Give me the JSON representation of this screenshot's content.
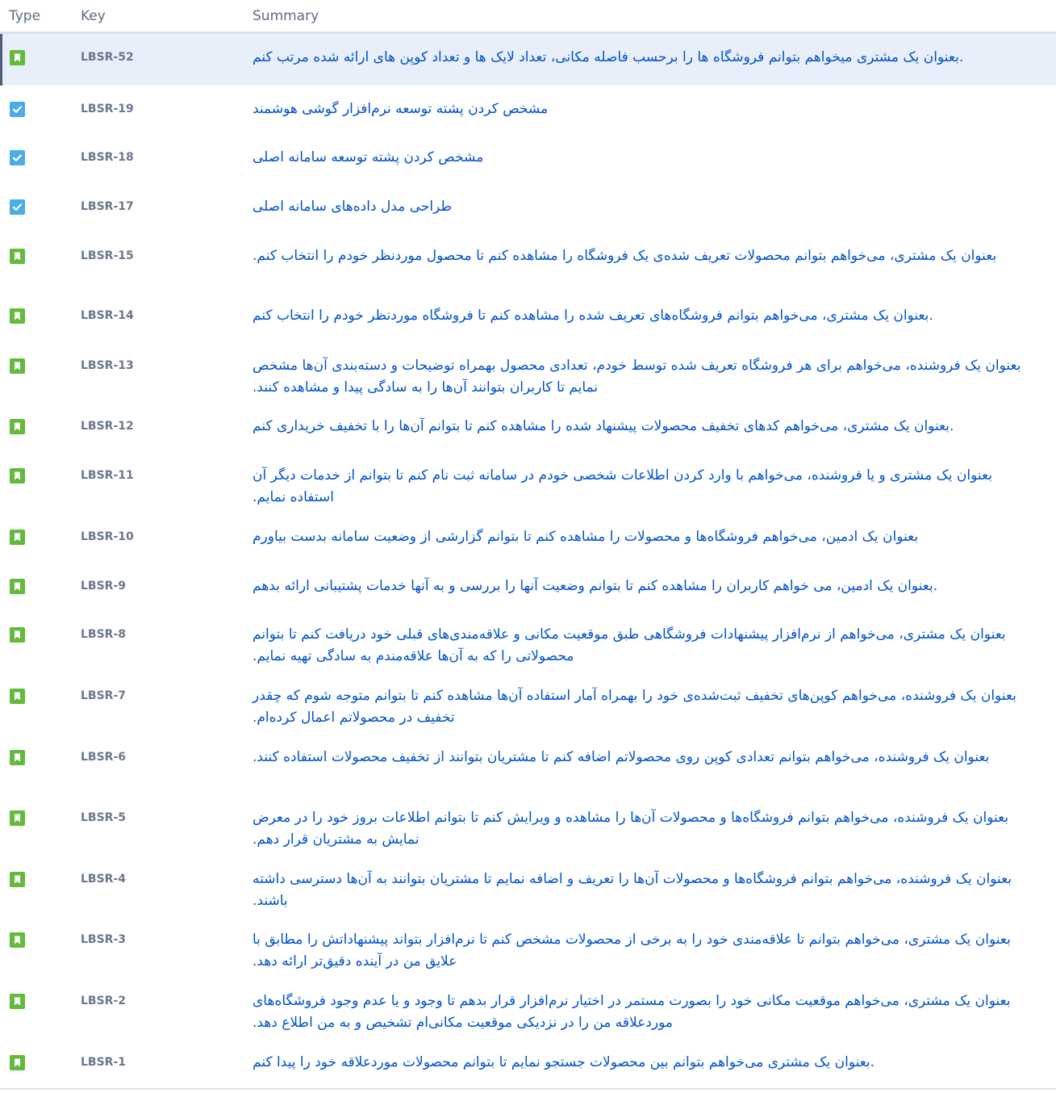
{
  "colors": {
    "story": "#63ba3c",
    "task": "#4bade8",
    "link": "#0052cc",
    "key": "#6b778c",
    "selected_row": "#e9effa"
  },
  "header": {
    "type": "Type",
    "key": "Key",
    "summary": "Summary"
  },
  "rows": [
    {
      "type": "story",
      "icon": "bookmark-icon",
      "key": "LBSR-52",
      "summary": ".بعنوان یک مشتری میخواهم بتوانم فروشگاه ها را برحسب فاصله مکانی، تعداد لایک ها و تعداد کوپن های ارائه شده مرتب کنم",
      "selected": true
    },
    {
      "type": "task",
      "icon": "checkbox-icon",
      "key": "LBSR-19",
      "summary": "مشخص کردن پشته توسعه نرم‌افزار گوشی هوشمند"
    },
    {
      "type": "task",
      "icon": "checkbox-icon",
      "key": "LBSR-18",
      "summary": "مشخص کردن پشته توسعه سامانه اصلی"
    },
    {
      "type": "task",
      "icon": "checkbox-icon",
      "key": "LBSR-17",
      "summary": "طراحی مدل داده‌های سامانه اصلی"
    },
    {
      "type": "story",
      "icon": "bookmark-icon",
      "key": "LBSR-15",
      "summary": "بعنوان یک مشتری، می‌خواهم بتوانم محصولات تعریف شده‌ی یک فروشگاه را مشاهده کنم تا محصول موردنظر خودم را انتخاب کنم."
    },
    {
      "type": "story",
      "icon": "bookmark-icon",
      "key": "LBSR-14",
      "summary": ".بعنوان یک مشتری، می‌خواهم بتوانم فروشگاه‌های تعریف شده را مشاهده کنم تا فروشگاه موردنظر خودم را انتخاب کنم"
    },
    {
      "type": "story",
      "icon": "bookmark-icon",
      "key": "LBSR-13",
      "summary": "بعنوان یک فروشنده، می‌خواهم برای هر فروشگاه تعریف شده توسط خودم، تعدادی محصول بهمراه توضیحات و دسته‌بندی آن‌ها مشخص نمایم تا کاربران بتوانند آن‌ها را به سادگی پیدا و مشاهده کنند."
    },
    {
      "type": "story",
      "icon": "bookmark-icon",
      "key": "LBSR-12",
      "summary": ".بعنوان یک مشتری، می‌خواهم کدهای تخفیف محصولات پیشنهاد شده را مشاهده کنم تا بتوانم آن‌ها را با تخفیف خریداری کنم"
    },
    {
      "type": "story",
      "icon": "bookmark-icon",
      "key": "LBSR-11",
      "summary": "بعنوان یک مشتری و یا فروشنده، می‌خواهم با وارد کردن اطلاعات شخصی خودم در سامانه ثبت نام کنم تا بتوانم از خدمات دیگر آن استفاده نمایم."
    },
    {
      "type": "story",
      "icon": "bookmark-icon",
      "key": "LBSR-10",
      "summary": "بعنوان یک ادمین، می‌خواهم فروشگاه‌ها و محصولات را مشاهده کنم تا بتوانم گزارشی از وضعیت سامانه بدست بیاورم"
    },
    {
      "type": "story",
      "icon": "bookmark-icon",
      "key": "LBSR-9",
      "summary": ".بعنوان یک ادمین، می خواهم کاربران را مشاهده کنم تا بتوانم وضعیت آنها را بررسی و به آنها خدمات پشتیبانی ارائه بدهم"
    },
    {
      "type": "story",
      "icon": "bookmark-icon",
      "key": "LBSR-8",
      "summary": "بعنوان یک مشتری، می‌خواهم از نرم‌افزار پیشنهادات فروشگاهی طبق موقعیت مکانی و علاقه‌مندی‌های قبلی خود دریافت کنم تا بتوانم محصولاتی را که به آن‌ها علاقه‌مندم به سادگی تهیه نمایم."
    },
    {
      "type": "story",
      "icon": "bookmark-icon",
      "key": "LBSR-7",
      "summary": "بعنوان یک فروشنده، می‌خواهم کوپن‌های تخفیف ثبت‌شده‌ی خود را بهمراه آمار استفاده آن‌ها مشاهده کنم تا بتوانم متوجه شوم که چقدر تخفیف در محصولاتم اعمال کرده‌ام."
    },
    {
      "type": "story",
      "icon": "bookmark-icon",
      "key": "LBSR-6",
      "summary": "بعنوان یک فروشنده، می‌خواهم بتوانم تعدادی کوپن روی محصولاتم اضافه کنم تا مشتریان بتوانند از تخفیف محصولات استفاده کنند."
    },
    {
      "type": "story",
      "icon": "bookmark-icon",
      "key": "LBSR-5",
      "summary": "بعنوان یک فروشنده، می‌خواهم بتوانم فروشگاه‌ها و محصولات آن‌ها را مشاهده و ویرایش کنم تا بتوانم اطلاعات بروز خود را در معرض نمایش به مشتریان قرار دهم."
    },
    {
      "type": "story",
      "icon": "bookmark-icon",
      "key": "LBSR-4",
      "summary": "بعنوان یک فروشنده، می‌خواهم بتوانم فروشگاه‌ها و محصولات آن‌ها را تعریف و اضافه نمایم تا مشتریان بتوانند به آن‌ها دسترسی داشته باشند."
    },
    {
      "type": "story",
      "icon": "bookmark-icon",
      "key": "LBSR-3",
      "summary": "بعنوان یک مشتری، می‌خواهم بتوانم تا علاقه‌مندی خود را به برخی از محصولات مشخص کنم تا نرم‌افزار بتواند پیشنهاداتش را مطابق با علایق من در آینده دقیق‌تر ارائه دهد."
    },
    {
      "type": "story",
      "icon": "bookmark-icon",
      "key": "LBSR-2",
      "summary": "بعنوان یک مشتری، می‌خواهم موقعیت مکانی خود را بصورت مستمر در اختیار نرم‌افزار قرار بدهم تا وجود و یا عدم وجود فروشگاه‌های موردعلاقه من را در نزدیکی موقعیت مکانی‌ام تشخیص و به من اطلاع دهد."
    },
    {
      "type": "story",
      "icon": "bookmark-icon",
      "key": "LBSR-1",
      "summary": ".بعنوان یک مشتری می‌خواهم بتوانم بین محصولات جستجو نمایم تا بتوانم محصولات موردعلاقه خود را پیدا کنم"
    }
  ]
}
